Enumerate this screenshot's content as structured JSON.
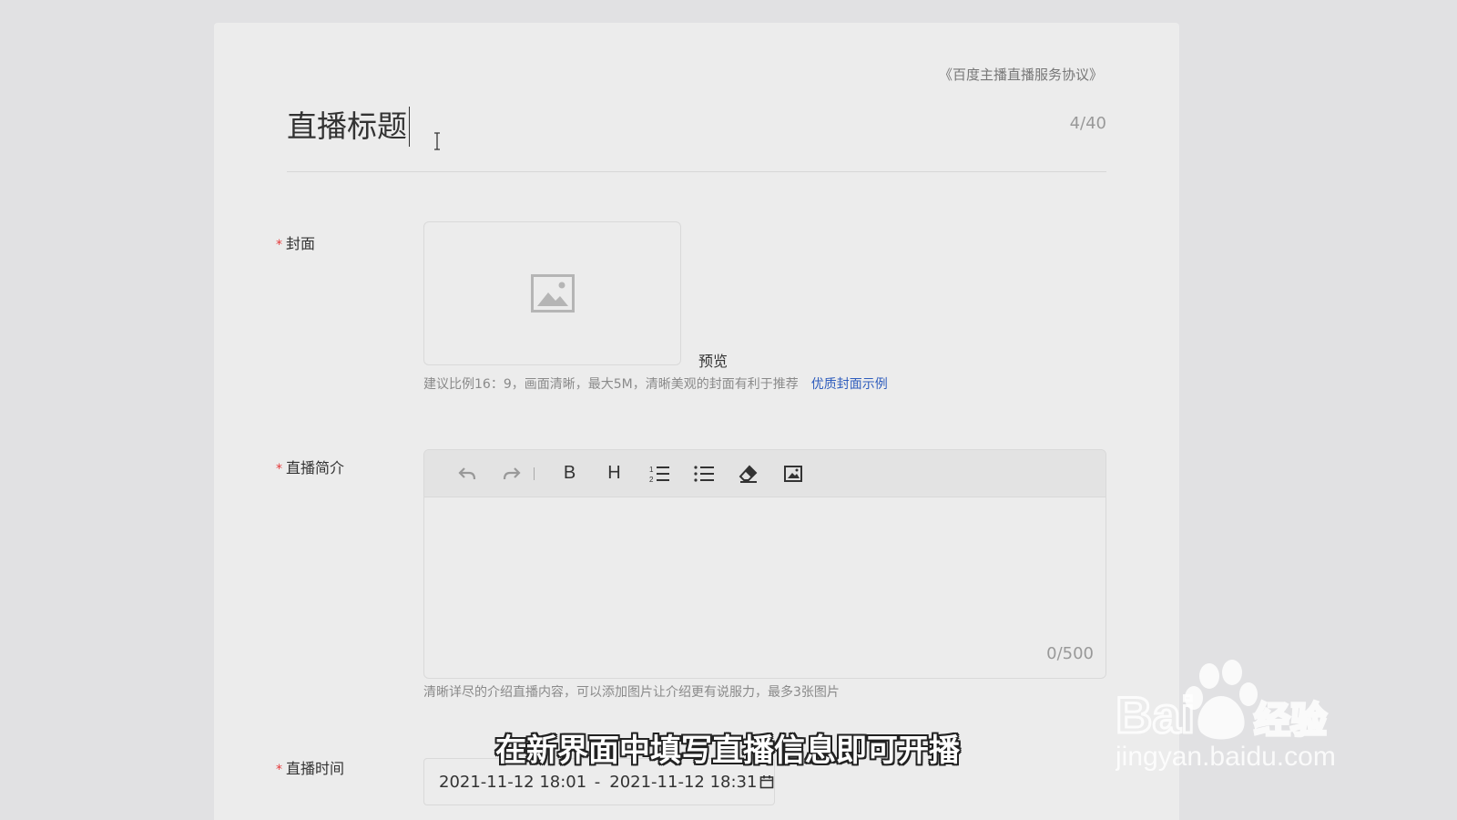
{
  "agreement": "《百度主播直播服务协议》",
  "title": {
    "value": "直播标题",
    "count": "4/40"
  },
  "cover": {
    "required": "*",
    "label": "封面",
    "preview": "预览",
    "hint": "建议比例16：9，画面清晰，最大5M，清晰美观的封面有利于推荐",
    "example_link": "优质封面示例"
  },
  "intro": {
    "required": "*",
    "label": "直播简介",
    "toolbar": [
      "undo-icon",
      "redo-icon",
      "separator",
      "bold",
      "heading",
      "ordered-list-icon",
      "bullet-list-icon",
      "eraser-icon",
      "image-icon"
    ],
    "bold_label": "B",
    "heading_label": "H",
    "count": "0/500",
    "hint": "清晰详尽的介绍直播内容，可以添加图片让介绍更有说服力，最多3张图片"
  },
  "time": {
    "required": "*",
    "label": "直播时间",
    "start": "2021-11-12 18:01",
    "dash": "-",
    "end": "2021-11-12 18:31"
  },
  "subtitle": "在新界面中填写直播信息即可开播",
  "watermark": {
    "brand": "Baidu",
    "cn": "经验",
    "url": "jingyan.baidu.com"
  }
}
